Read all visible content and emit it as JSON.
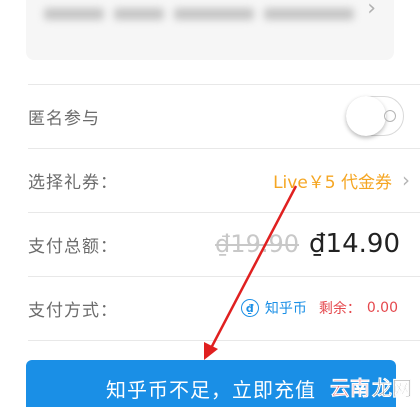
{
  "anonymous": {
    "label": "匿名参与",
    "enabled": false
  },
  "gift_coupon": {
    "label": "选择礼券：",
    "value": "Live￥5 代金券"
  },
  "total": {
    "label": "支付总额：",
    "original": "₫19.90",
    "final": "₫14.90"
  },
  "payment": {
    "label": "支付方式：",
    "method": "知乎币",
    "coin_glyph": "₫",
    "remain_label": "剩余：",
    "remain_value": "0.00"
  },
  "cta": {
    "label": "知乎币不足，立即充值"
  },
  "watermark": {
    "part1": "云南",
    "part2": "龙网"
  },
  "colors": {
    "primary": "#1a8fe6",
    "coupon": "#f5a623",
    "alert": "#e5484d"
  }
}
